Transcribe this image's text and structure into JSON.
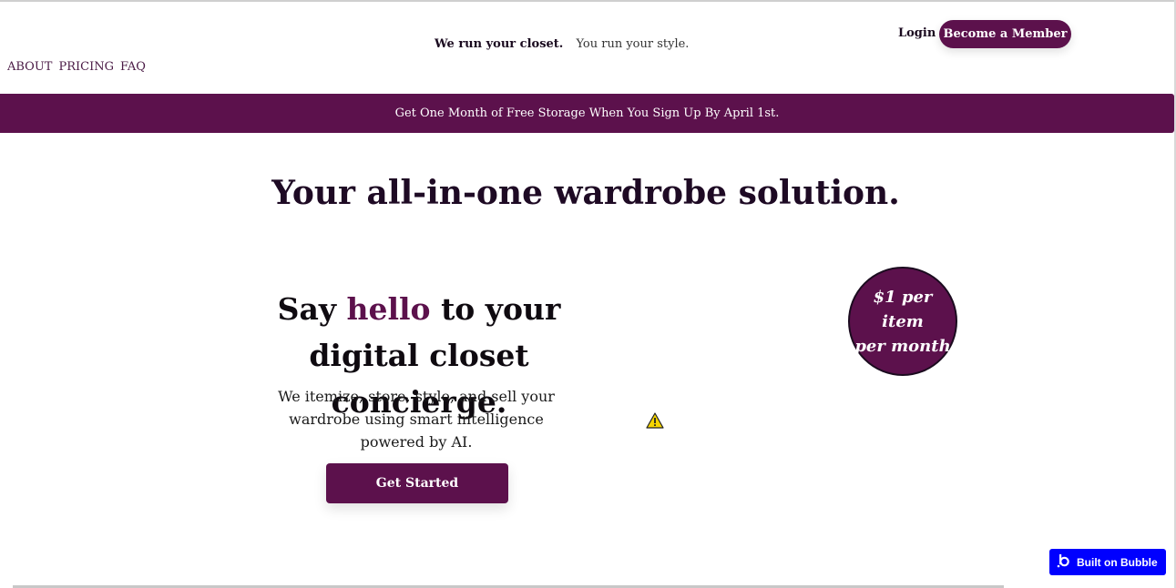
{
  "header": {
    "tagline_strong": "We run your closet.",
    "tagline_light": "You run your style.",
    "nav": [
      {
        "label": "ABOUT"
      },
      {
        "label": "PRICING"
      },
      {
        "label": "FAQ"
      }
    ],
    "login_label": "Login",
    "member_label": "Become a Member"
  },
  "promo": {
    "text": "Get One Month of Free Storage When You Sign Up By April 1st."
  },
  "main": {
    "headline": "Your all-in-one wardrobe solution.",
    "hero": {
      "title_pre": "Say ",
      "title_accent": "hello",
      "title_post": " to your digital closet concierge.",
      "subtitle": "We itemize, store, style, and sell your wardrobe using smart intelligence powered by AI.",
      "cta_label": "Get Started"
    },
    "price_badge": {
      "line1": "$1 per item",
      "line2": "per month"
    },
    "warning_icon": "warning-triangle-icon"
  },
  "footer_badge": {
    "label": "Built on Bubble",
    "icon": "bubble-logo-icon"
  },
  "colors": {
    "brand": "#5c114c",
    "bubble_blue": "#0000ff",
    "warning_yellow": "#f5d400"
  }
}
